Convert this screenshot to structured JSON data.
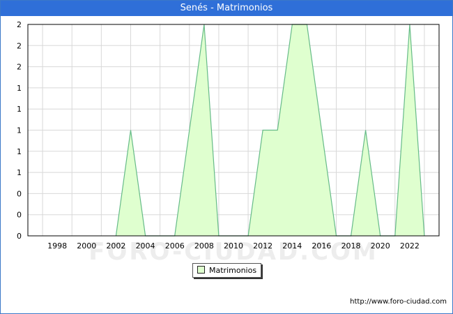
{
  "title": "Senés - Matrimonios",
  "source_url": "http://www.foro-ciudad.com",
  "watermark": "FORO-CIUDAD.COM",
  "colors": {
    "title_bar": "#2f6fd8",
    "area_fill": "#dfffcf",
    "area_line": "#66bb88",
    "grid": "#d8d8d8"
  },
  "chart_data": {
    "type": "area",
    "title": "Senés - Matrimonios",
    "x_tick_labels": [
      "1998",
      "2000",
      "2002",
      "2004",
      "2006",
      "2008",
      "2010",
      "2012",
      "2014",
      "2016",
      "2018",
      "2020",
      "2022"
    ],
    "y_tick_labels": [
      "0",
      "0",
      "0",
      "1",
      "1",
      "1",
      "1",
      "1",
      "2",
      "2",
      "2"
    ],
    "xlim": [
      1996,
      2024
    ],
    "ylim": [
      0,
      2
    ],
    "grid": true,
    "legend_position": "bottom-center",
    "series": [
      {
        "name": "Matrimonios",
        "x": [
          2002,
          2003,
          2004,
          2006,
          2008,
          2009,
          2011,
          2012,
          2013,
          2014,
          2015,
          2016,
          2017,
          2018,
          2019,
          2020,
          2021,
          2022,
          2023
        ],
        "values": [
          0,
          1,
          0,
          0,
          2,
          0,
          0,
          1,
          1,
          2,
          2,
          1,
          0,
          0,
          1,
          0,
          0,
          2,
          0
        ]
      }
    ]
  }
}
